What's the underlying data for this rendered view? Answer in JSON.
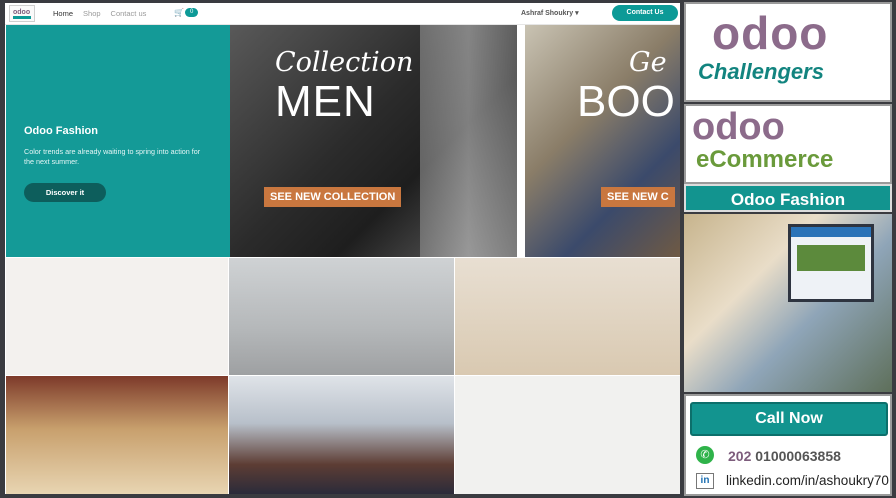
{
  "nav": {
    "links": [
      "Home",
      "Shop",
      "Contact us"
    ],
    "cart_count": "0",
    "user": "Ashraf Shoukry ▾",
    "contact_button": "Contact Us"
  },
  "hero": {
    "title": "Odoo Fashion",
    "text": "Color trends are already waiting to spring into action for the next summer.",
    "button": "Discover it"
  },
  "banners": [
    {
      "script": "Collection",
      "big": "MEN",
      "cta": "SEE NEW COLLECTION"
    },
    {
      "script": "Ge",
      "big": "BOO",
      "cta": "SEE NEW C"
    }
  ],
  "promo": {
    "brand": "odoo",
    "tagline": "Challengers",
    "brand2": "odoo",
    "product": "eCommerce",
    "title": "Odoo Fashion",
    "call_button": "Call Now",
    "phone_cc": "202",
    "phone": "01000063858",
    "linkedin": "linkedin.com/in/ashoukry70",
    "linkedin_icon_text": "in",
    "colors": {
      "teal": "#12948f",
      "purple": "#8c6b8b",
      "green": "#6a9a3b"
    }
  }
}
